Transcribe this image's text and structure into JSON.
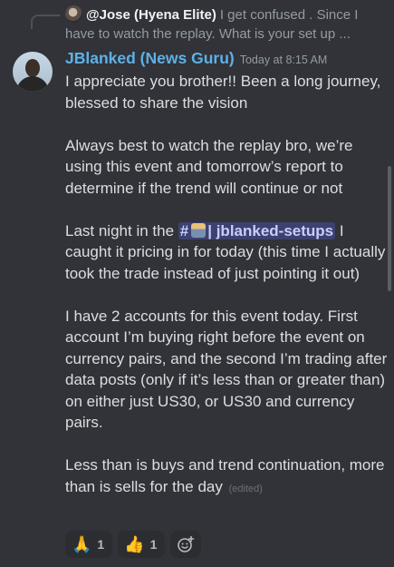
{
  "reply": {
    "author": "@Jose (Hyena Elite)",
    "preview": "I get confused  . Since I have to watch the replay. What is your set up ..."
  },
  "message": {
    "author": "JBlanked (News Guru)",
    "timestamp": "Today at 8:15 AM",
    "paragraph1": "I appreciate you brother!! Been a long journey, blessed to share the vision",
    "paragraph2": "Always best to watch the replay bro, we’re using this event and tomorrow’s report to determine if the trend will continue or not",
    "paragraph3_before": "Last night in the ",
    "channel_mention": "| jblanked-setups",
    "paragraph3_after": " I caught it pricing in for today (this time I actually took the trade instead of just pointing it out)",
    "paragraph4": "I have 2 accounts for this event today. First account I’m buying right before the event on currency pairs, and the second I’m trading after data posts (only if it’s less than or greater than) on either just US30, or US30 and currency pairs.",
    "paragraph5": "Less than is buys and trend continuation, more than is sells for the day",
    "edited_label": "(edited)"
  },
  "reactions": [
    {
      "emoji": "🙏",
      "count": "1"
    },
    {
      "emoji": "👍",
      "count": "1"
    }
  ],
  "colors": {
    "background": "#313338",
    "author": "#5fb0e6",
    "mention_bg": "#4a5096"
  }
}
